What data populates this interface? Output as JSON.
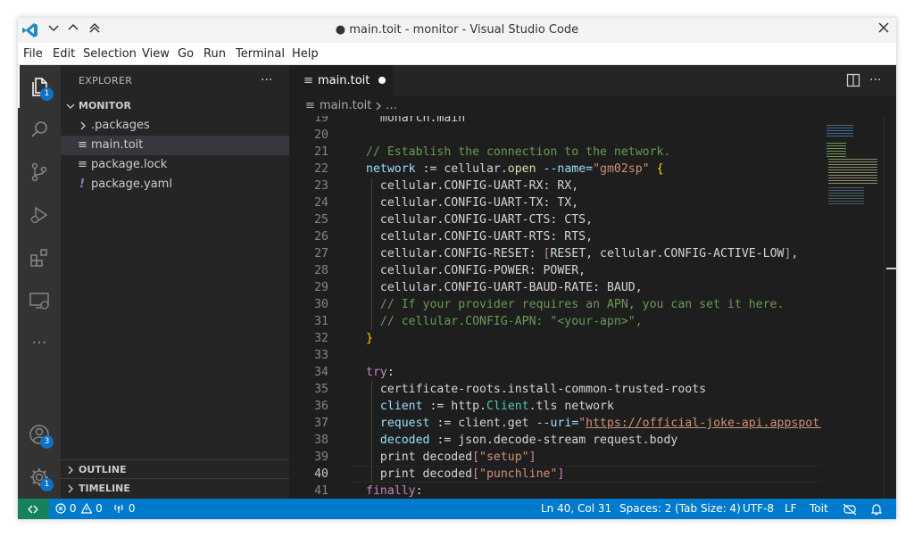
{
  "window": {
    "title": "● main.toit - monitor - Visual Studio Code",
    "menu": [
      "File",
      "Edit",
      "Selection",
      "View",
      "Go",
      "Run",
      "Terminal",
      "Help"
    ]
  },
  "activity_bar": {
    "items": [
      {
        "name": "explorer-icon",
        "badge": "1"
      },
      {
        "name": "search-icon"
      },
      {
        "name": "source-control-icon"
      },
      {
        "name": "run-debug-icon"
      },
      {
        "name": "extensions-icon"
      },
      {
        "name": "remote-explorer-icon"
      },
      {
        "name": "more-icon",
        "label": "···"
      }
    ],
    "accounts_badge": "3",
    "settings_badge": "1"
  },
  "sidebar": {
    "title": "EXPLORER",
    "more": "···",
    "folder": "MONITOR",
    "items": [
      {
        "label": ".packages",
        "type": "folder"
      },
      {
        "label": "main.toit",
        "type": "file",
        "icon": "≡"
      },
      {
        "label": "package.lock",
        "type": "file",
        "icon": "≡"
      },
      {
        "label": "package.yaml",
        "type": "yaml",
        "icon": "!"
      }
    ],
    "outline": "OUTLINE",
    "timeline": "TIMELINE"
  },
  "editor": {
    "tab_label": "main.toit",
    "tab_icon": "≡",
    "breadcrumb_file": "main.toit",
    "breadcrumb_more": "…",
    "active_line": "40",
    "lines": [
      {
        "n": "19",
        "parts": [
          {
            "t": "  monarch.main",
            "c": ""
          }
        ]
      },
      {
        "n": "20",
        "parts": []
      },
      {
        "n": "21",
        "parts": [
          {
            "t": "// Establish the connection to the network.",
            "c": "c-com"
          }
        ]
      },
      {
        "n": "22",
        "parts": [
          {
            "t": "network",
            "c": "c-var"
          },
          {
            "t": " := cellular.",
            "c": ""
          },
          {
            "t": "open",
            "c": "c-fn"
          },
          {
            "t": " --name=",
            "c": "c-var"
          },
          {
            "t": "\"gm02sp\"",
            "c": "c-str"
          },
          {
            "t": " {",
            "c": "c-brace"
          }
        ]
      },
      {
        "n": "23",
        "parts": [
          {
            "t": "  cellular.CONFIG-UART-RX: RX,",
            "c": ""
          }
        ]
      },
      {
        "n": "24",
        "parts": [
          {
            "t": "  cellular.CONFIG-UART-TX: TX,",
            "c": ""
          }
        ]
      },
      {
        "n": "25",
        "parts": [
          {
            "t": "  cellular.CONFIG-UART-CTS: CTS,",
            "c": ""
          }
        ]
      },
      {
        "n": "26",
        "parts": [
          {
            "t": "  cellular.CONFIG-UART-RTS: RTS,",
            "c": ""
          }
        ]
      },
      {
        "n": "27",
        "parts": [
          {
            "t": "  cellular.CONFIG-RESET: ",
            "c": ""
          },
          {
            "t": "[",
            "c": "c-kw"
          },
          {
            "t": "RESET, cellular.CONFIG-ACTIVE-LOW",
            "c": ""
          },
          {
            "t": "]",
            "c": "c-kw"
          },
          {
            "t": ",",
            "c": ""
          }
        ]
      },
      {
        "n": "28",
        "parts": [
          {
            "t": "  cellular.CONFIG-POWER: POWER,",
            "c": ""
          }
        ]
      },
      {
        "n": "29",
        "parts": [
          {
            "t": "  cellular.CONFIG-UART-BAUD-RATE: BAUD,",
            "c": ""
          }
        ]
      },
      {
        "n": "30",
        "parts": [
          {
            "t": "  // If your provider requires an APN, you can set it here.",
            "c": "c-com"
          }
        ]
      },
      {
        "n": "31",
        "parts": [
          {
            "t": "  // cellular.CONFIG-APN: \"<your-apn>\",",
            "c": "c-com"
          }
        ]
      },
      {
        "n": "32",
        "parts": [
          {
            "t": "}",
            "c": "c-brace"
          }
        ]
      },
      {
        "n": "33",
        "parts": []
      },
      {
        "n": "34",
        "parts": [
          {
            "t": "try",
            "c": "c-kw"
          },
          {
            "t": ":",
            "c": ""
          }
        ]
      },
      {
        "n": "35",
        "parts": [
          {
            "t": "  certificate-roots.install-common-trusted-roots",
            "c": ""
          }
        ]
      },
      {
        "n": "36",
        "parts": [
          {
            "t": "  ",
            "c": ""
          },
          {
            "t": "client",
            "c": "c-var"
          },
          {
            "t": " := http.",
            "c": ""
          },
          {
            "t": "Client",
            "c": "c-cls"
          },
          {
            "t": ".tls network",
            "c": ""
          }
        ]
      },
      {
        "n": "37",
        "parts": [
          {
            "t": "  ",
            "c": ""
          },
          {
            "t": "request",
            "c": "c-var"
          },
          {
            "t": " := client.get ",
            "c": ""
          },
          {
            "t": "--uri=",
            "c": "c-var"
          },
          {
            "t": "\"",
            "c": "c-str"
          },
          {
            "t": "https://official-joke-api.appspot.com",
            "c": "c-url"
          }
        ]
      },
      {
        "n": "38",
        "parts": [
          {
            "t": "  ",
            "c": ""
          },
          {
            "t": "decoded",
            "c": "c-var"
          },
          {
            "t": " := json.decode-stream request.body",
            "c": ""
          }
        ]
      },
      {
        "n": "39",
        "parts": [
          {
            "t": "  print decoded",
            "c": ""
          },
          {
            "t": "[",
            "c": "c-kw"
          },
          {
            "t": "\"setup\"",
            "c": "c-str"
          },
          {
            "t": "]",
            "c": "c-kw"
          }
        ]
      },
      {
        "n": "40",
        "parts": [
          {
            "t": "  print decoded",
            "c": ""
          },
          {
            "t": "[",
            "c": "c-kw"
          },
          {
            "t": "\"punchline\"",
            "c": "c-str"
          },
          {
            "t": "]",
            "c": "c-kw"
          }
        ]
      },
      {
        "n": "41",
        "parts": [
          {
            "t": "finally",
            "c": "c-kw"
          },
          {
            "t": ":",
            "c": ""
          }
        ]
      }
    ]
  },
  "status_bar": {
    "errors": "0",
    "warnings": "0",
    "ports": "0",
    "position": "Ln 40, Col 31",
    "spaces": "Spaces: 2 (Tab Size: 4)",
    "encoding": "UTF-8",
    "eol": "LF",
    "language": "Toit"
  },
  "colors": {
    "accent": "#007acc",
    "editor_bg": "#1e1e1e",
    "sidebar_bg": "#252526",
    "activity_bg": "#333333"
  }
}
